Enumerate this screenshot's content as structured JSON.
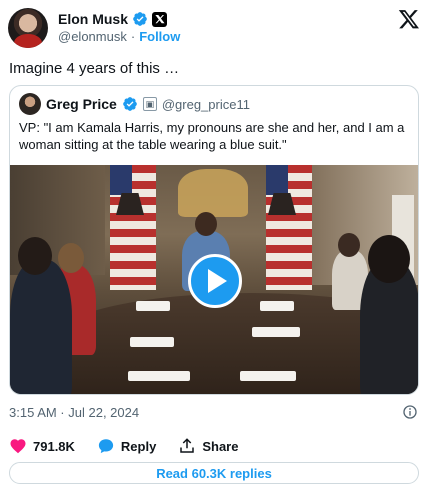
{
  "author": {
    "name": "Elon Musk",
    "handle": "@elonmusk",
    "separator": "·",
    "follow_label": "Follow",
    "avatar_icon": "avatar",
    "verified_icon": "verified-badge-icon",
    "affiliate_icon": "x-affiliate-badge-icon"
  },
  "platform_logo": "x-logo-icon",
  "tweet": {
    "text": "Imagine 4 years of this …",
    "timestamp": "3:15 AM · Jul 22, 2024"
  },
  "quoted": {
    "name": "Greg Price",
    "handle": "@greg_price11",
    "text": "VP: \"I am Kamala Harris, my pronouns are she and her, and I am a woman sitting at the table wearing a blue suit.\"",
    "media": "video",
    "play_icon": "play-icon"
  },
  "actions": {
    "like_count": "791.8K",
    "reply_label": "Reply",
    "share_label": "Share"
  },
  "read_replies_label": "Read 60.3K replies",
  "colors": {
    "accent": "#1d9bf0",
    "like": "#f91880",
    "text": "#0f1419",
    "muted": "#536471",
    "border": "#cfd9de"
  }
}
